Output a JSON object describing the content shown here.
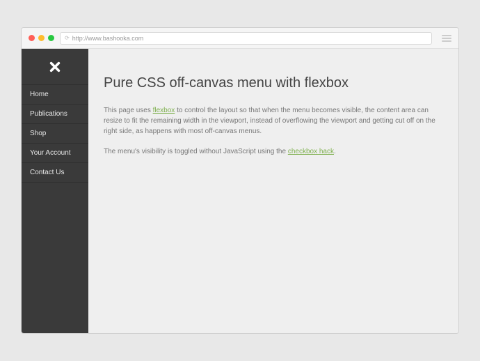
{
  "browser": {
    "url": "http://www.bashooka.com"
  },
  "sidebar": {
    "items": [
      {
        "label": "Home"
      },
      {
        "label": "Publications"
      },
      {
        "label": "Shop"
      },
      {
        "label": "Your Account"
      },
      {
        "label": "Contact Us"
      }
    ]
  },
  "content": {
    "title": "Pure CSS off-canvas menu with flexbox",
    "p1_before": "This page uses ",
    "p1_link": "flexbox",
    "p1_after": " to control the layout so that when the menu becomes visible, the content area can resize to fit the remaining width in the viewport, instead of overflowing the viewport and getting cut off on the right side, as happens with most off-canvas menus.",
    "p2_before": "The menu's visibility is toggled without JavaScript using the ",
    "p2_link": "checkbox hack",
    "p2_after": "."
  }
}
